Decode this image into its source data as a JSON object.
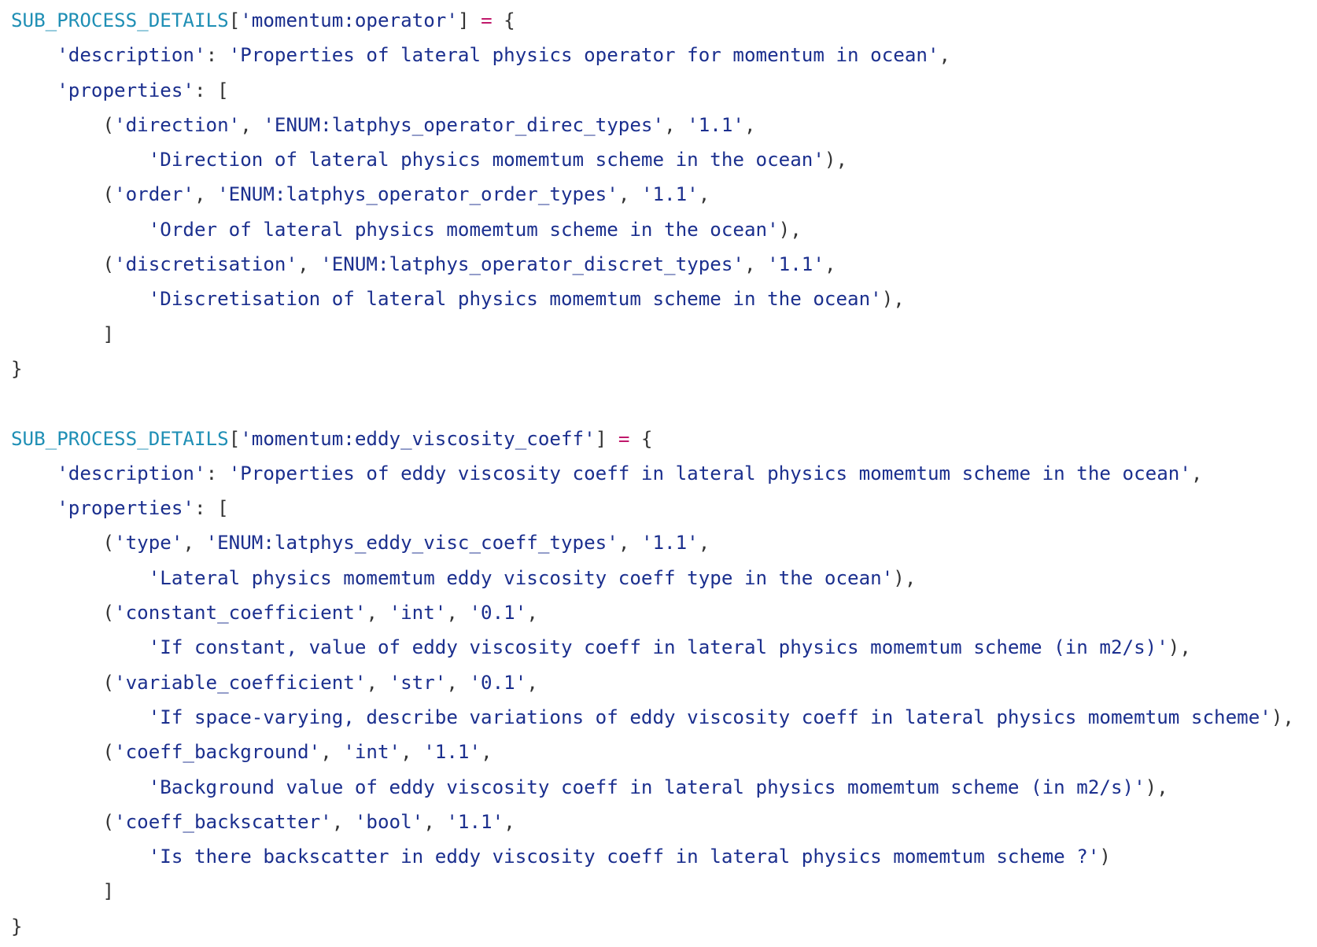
{
  "colors": {
    "identifier": "#1f8fb5",
    "string": "#1b2f8e",
    "punctuation": "#333333",
    "operator": "#c0186b",
    "background": "#ffffff"
  },
  "code": {
    "lines": [
      [
        {
          "t": "SUB_PROCESS_DETAILS",
          "k": "ident"
        },
        {
          "t": "[",
          "k": "punct"
        },
        {
          "t": "'momentum:operator'",
          "k": "str"
        },
        {
          "t": "] ",
          "k": "punct"
        },
        {
          "t": "=",
          "k": "op"
        },
        {
          "t": " {",
          "k": "punct"
        }
      ],
      [
        {
          "t": "    ",
          "k": "punct"
        },
        {
          "t": "'description'",
          "k": "str"
        },
        {
          "t": ": ",
          "k": "punct"
        },
        {
          "t": "'Properties of lateral physics operator for momentum in ocean'",
          "k": "str"
        },
        {
          "t": ",",
          "k": "punct"
        }
      ],
      [
        {
          "t": "    ",
          "k": "punct"
        },
        {
          "t": "'properties'",
          "k": "str"
        },
        {
          "t": ": [",
          "k": "punct"
        }
      ],
      [
        {
          "t": "        (",
          "k": "punct"
        },
        {
          "t": "'direction'",
          "k": "str"
        },
        {
          "t": ", ",
          "k": "punct"
        },
        {
          "t": "'ENUM:latphys_operator_direc_types'",
          "k": "str"
        },
        {
          "t": ", ",
          "k": "punct"
        },
        {
          "t": "'1.1'",
          "k": "str"
        },
        {
          "t": ",",
          "k": "punct"
        }
      ],
      [
        {
          "t": "            ",
          "k": "punct"
        },
        {
          "t": "'Direction of lateral physics momemtum scheme in the ocean'",
          "k": "str"
        },
        {
          "t": "),",
          "k": "punct"
        }
      ],
      [
        {
          "t": "        (",
          "k": "punct"
        },
        {
          "t": "'order'",
          "k": "str"
        },
        {
          "t": ", ",
          "k": "punct"
        },
        {
          "t": "'ENUM:latphys_operator_order_types'",
          "k": "str"
        },
        {
          "t": ", ",
          "k": "punct"
        },
        {
          "t": "'1.1'",
          "k": "str"
        },
        {
          "t": ",",
          "k": "punct"
        }
      ],
      [
        {
          "t": "            ",
          "k": "punct"
        },
        {
          "t": "'Order of lateral physics momemtum scheme in the ocean'",
          "k": "str"
        },
        {
          "t": "),",
          "k": "punct"
        }
      ],
      [
        {
          "t": "        (",
          "k": "punct"
        },
        {
          "t": "'discretisation'",
          "k": "str"
        },
        {
          "t": ", ",
          "k": "punct"
        },
        {
          "t": "'ENUM:latphys_operator_discret_types'",
          "k": "str"
        },
        {
          "t": ", ",
          "k": "punct"
        },
        {
          "t": "'1.1'",
          "k": "str"
        },
        {
          "t": ",",
          "k": "punct"
        }
      ],
      [
        {
          "t": "            ",
          "k": "punct"
        },
        {
          "t": "'Discretisation of lateral physics momemtum scheme in the ocean'",
          "k": "str"
        },
        {
          "t": "),",
          "k": "punct"
        }
      ],
      [
        {
          "t": "        ]",
          "k": "punct"
        }
      ],
      [
        {
          "t": "}",
          "k": "punct"
        }
      ],
      [],
      [
        {
          "t": "SUB_PROCESS_DETAILS",
          "k": "ident"
        },
        {
          "t": "[",
          "k": "punct"
        },
        {
          "t": "'momentum:eddy_viscosity_coeff'",
          "k": "str"
        },
        {
          "t": "] ",
          "k": "punct"
        },
        {
          "t": "=",
          "k": "op"
        },
        {
          "t": " {",
          "k": "punct"
        }
      ],
      [
        {
          "t": "    ",
          "k": "punct"
        },
        {
          "t": "'description'",
          "k": "str"
        },
        {
          "t": ": ",
          "k": "punct"
        },
        {
          "t": "'Properties of eddy viscosity coeff in lateral physics momemtum scheme in the ocean'",
          "k": "str"
        },
        {
          "t": ",",
          "k": "punct"
        }
      ],
      [
        {
          "t": "    ",
          "k": "punct"
        },
        {
          "t": "'properties'",
          "k": "str"
        },
        {
          "t": ": [",
          "k": "punct"
        }
      ],
      [
        {
          "t": "        (",
          "k": "punct"
        },
        {
          "t": "'type'",
          "k": "str"
        },
        {
          "t": ", ",
          "k": "punct"
        },
        {
          "t": "'ENUM:latphys_eddy_visc_coeff_types'",
          "k": "str"
        },
        {
          "t": ", ",
          "k": "punct"
        },
        {
          "t": "'1.1'",
          "k": "str"
        },
        {
          "t": ",",
          "k": "punct"
        }
      ],
      [
        {
          "t": "            ",
          "k": "punct"
        },
        {
          "t": "'Lateral physics momemtum eddy viscosity coeff type in the ocean'",
          "k": "str"
        },
        {
          "t": "),",
          "k": "punct"
        }
      ],
      [
        {
          "t": "        (",
          "k": "punct"
        },
        {
          "t": "'constant_coefficient'",
          "k": "str"
        },
        {
          "t": ", ",
          "k": "punct"
        },
        {
          "t": "'int'",
          "k": "str"
        },
        {
          "t": ", ",
          "k": "punct"
        },
        {
          "t": "'0.1'",
          "k": "str"
        },
        {
          "t": ",",
          "k": "punct"
        }
      ],
      [
        {
          "t": "            ",
          "k": "punct"
        },
        {
          "t": "'If constant, value of eddy viscosity coeff in lateral physics momemtum scheme (in m2/s)'",
          "k": "str"
        },
        {
          "t": "),",
          "k": "punct"
        }
      ],
      [
        {
          "t": "        (",
          "k": "punct"
        },
        {
          "t": "'variable_coefficient'",
          "k": "str"
        },
        {
          "t": ", ",
          "k": "punct"
        },
        {
          "t": "'str'",
          "k": "str"
        },
        {
          "t": ", ",
          "k": "punct"
        },
        {
          "t": "'0.1'",
          "k": "str"
        },
        {
          "t": ",",
          "k": "punct"
        }
      ],
      [
        {
          "t": "            ",
          "k": "punct"
        },
        {
          "t": "'If space-varying, describe variations of eddy viscosity coeff in lateral physics momemtum scheme'",
          "k": "str"
        },
        {
          "t": "),",
          "k": "punct"
        }
      ],
      [
        {
          "t": "        (",
          "k": "punct"
        },
        {
          "t": "'coeff_background'",
          "k": "str"
        },
        {
          "t": ", ",
          "k": "punct"
        },
        {
          "t": "'int'",
          "k": "str"
        },
        {
          "t": ", ",
          "k": "punct"
        },
        {
          "t": "'1.1'",
          "k": "str"
        },
        {
          "t": ",",
          "k": "punct"
        }
      ],
      [
        {
          "t": "            ",
          "k": "punct"
        },
        {
          "t": "'Background value of eddy viscosity coeff in lateral physics momemtum scheme (in m2/s)'",
          "k": "str"
        },
        {
          "t": "),",
          "k": "punct"
        }
      ],
      [
        {
          "t": "        (",
          "k": "punct"
        },
        {
          "t": "'coeff_backscatter'",
          "k": "str"
        },
        {
          "t": ", ",
          "k": "punct"
        },
        {
          "t": "'bool'",
          "k": "str"
        },
        {
          "t": ", ",
          "k": "punct"
        },
        {
          "t": "'1.1'",
          "k": "str"
        },
        {
          "t": ",",
          "k": "punct"
        }
      ],
      [
        {
          "t": "            ",
          "k": "punct"
        },
        {
          "t": "'Is there backscatter in eddy viscosity coeff in lateral physics momemtum scheme ?'",
          "k": "str"
        },
        {
          "t": ")",
          "k": "punct"
        }
      ],
      [
        {
          "t": "        ]",
          "k": "punct"
        }
      ],
      [
        {
          "t": "}",
          "k": "punct"
        }
      ]
    ]
  }
}
